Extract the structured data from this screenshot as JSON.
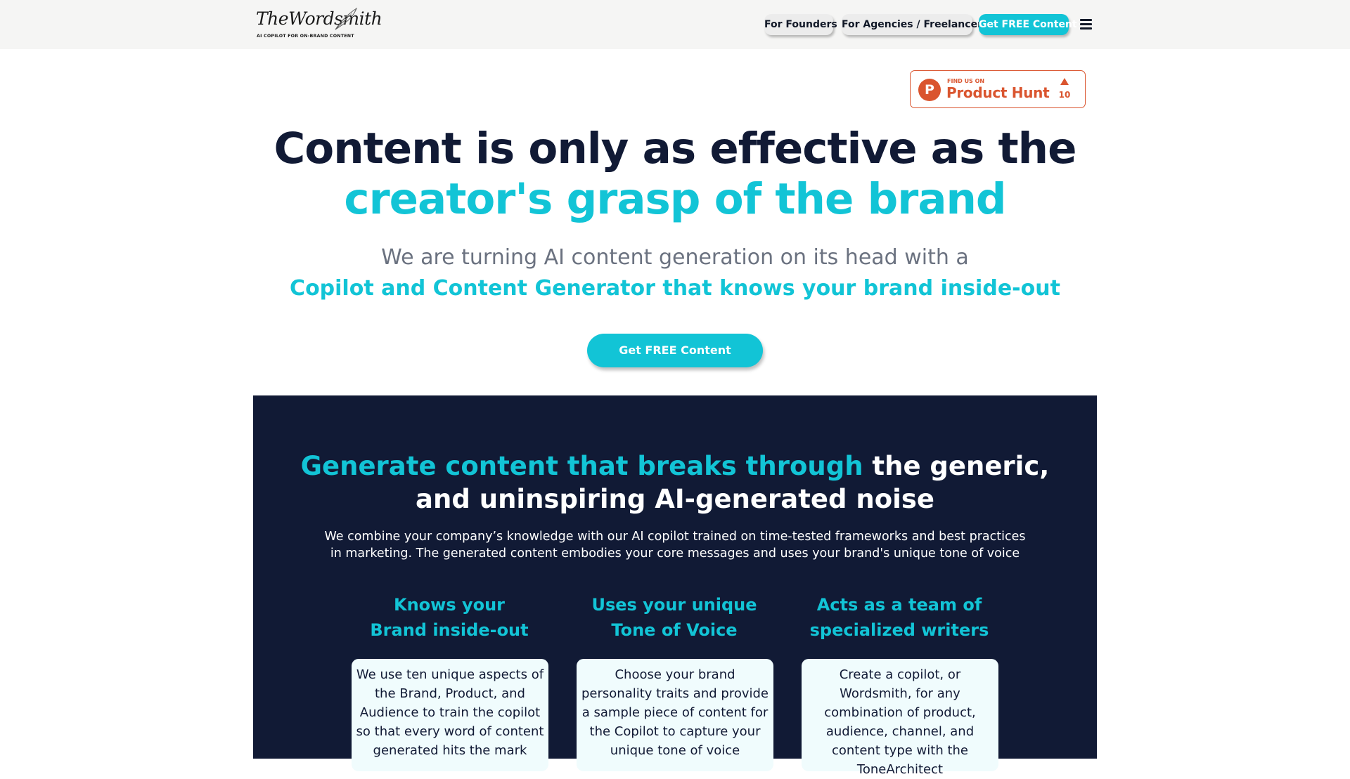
{
  "nav": {
    "logo_text": "TheWordsmith",
    "logo_tagline": "AI COPILOT FOR ON-BRAND CONTENT",
    "links": [
      {
        "label": "For Founders"
      },
      {
        "label": "For Agencies / Freelancers"
      }
    ],
    "cta_label": "Get FREE Content",
    "menu_icon": "hamburger-menu-icon"
  },
  "product_hunt": {
    "small_text": "FIND US ON",
    "big_text": "Product Hunt",
    "logo_letter": "P",
    "upvotes": "10",
    "brand_color": "#da552f"
  },
  "hero": {
    "line_1": "Content is only as effective as the",
    "line_2": "creator's grasp of the brand",
    "sub_1": "We are turning AI content generation on its head with a",
    "sub_2": "Copilot and Content Generator that knows your brand inside-out",
    "cta_label": "Get FREE Content"
  },
  "features_section": {
    "heading_teal": "Generate content that breaks through",
    "heading_white_1": " the generic,",
    "heading_white_2": "and uninspiring AI-generated noise",
    "desc_1": "We combine your company’s knowledge with our AI copilot trained on time-tested frameworks and best practices",
    "desc_2": "in marketing. The generated content embodies your core messages and uses your brand's unique tone of voice",
    "features": [
      {
        "title_1": "Knows your",
        "title_2": "Brand inside-out",
        "body": "We use ten unique aspects of the Brand, Product, and Audience to train the copilot so that every word of content generated hits the mark"
      },
      {
        "title_1": "Uses your unique",
        "title_2": "Tone of Voice",
        "body": "Choose your brand personality traits and provide a sample piece of content for the Copilot to capture your unique tone of voice"
      },
      {
        "title_1": "Acts as a team of",
        "title_2": "specialized writers",
        "body": "Create a copilot, or Wordsmith, for any combination of product, audience, channel, and content type with the ToneArchitect"
      }
    ]
  },
  "colors": {
    "accent": "#12c4d6",
    "navy": "#111a35",
    "muted_text": "#6b7280",
    "nav_bg": "#f5f5f4"
  }
}
